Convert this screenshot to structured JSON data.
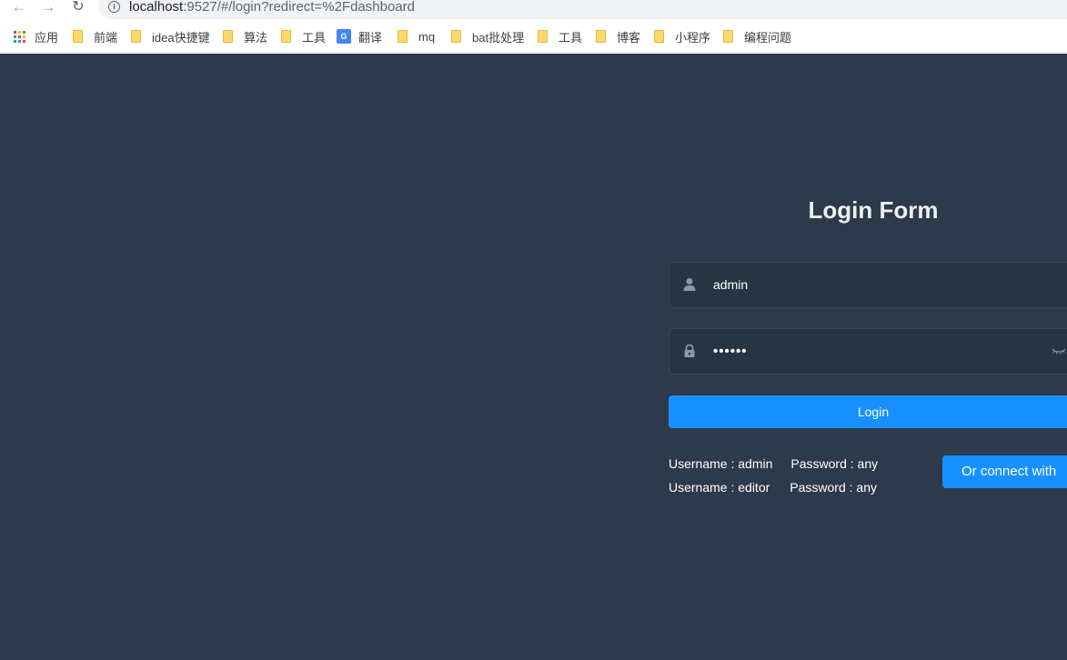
{
  "browser": {
    "url_host": "localhost",
    "url_rest": ":9527/#/login?redirect=%2Fdashboard",
    "bookmarks": [
      {
        "label": "应用",
        "icon": "apps-grid-icon"
      },
      {
        "label": "前端",
        "icon": "folder-icon"
      },
      {
        "label": "idea快捷键",
        "icon": "folder-icon"
      },
      {
        "label": "算法",
        "icon": "folder-icon"
      },
      {
        "label": "工具",
        "icon": "folder-icon"
      },
      {
        "label": "翻译",
        "icon": "google-translate-icon"
      },
      {
        "label": "mq",
        "icon": "folder-icon"
      },
      {
        "label": "bat批处理",
        "icon": "folder-icon"
      },
      {
        "label": "工具",
        "icon": "folder-icon"
      },
      {
        "label": "博客",
        "icon": "folder-icon"
      },
      {
        "label": "小程序",
        "icon": "folder-icon"
      },
      {
        "label": "编程问题",
        "icon": "folder-icon"
      }
    ]
  },
  "login": {
    "title": "Login Form",
    "username_value": "admin",
    "password_value": "••••••",
    "login_label": "Login",
    "tips": [
      {
        "username": "Username : admin",
        "password": "Password : any"
      },
      {
        "username": "Username : editor",
        "password": "Password : any"
      }
    ],
    "connect_label": "Or connect with"
  },
  "colors": {
    "background": "#2d3a4b",
    "input_bg": "#283443",
    "primary": "#1890ff",
    "title": "#eeeeee",
    "icon": "#889aa4"
  }
}
